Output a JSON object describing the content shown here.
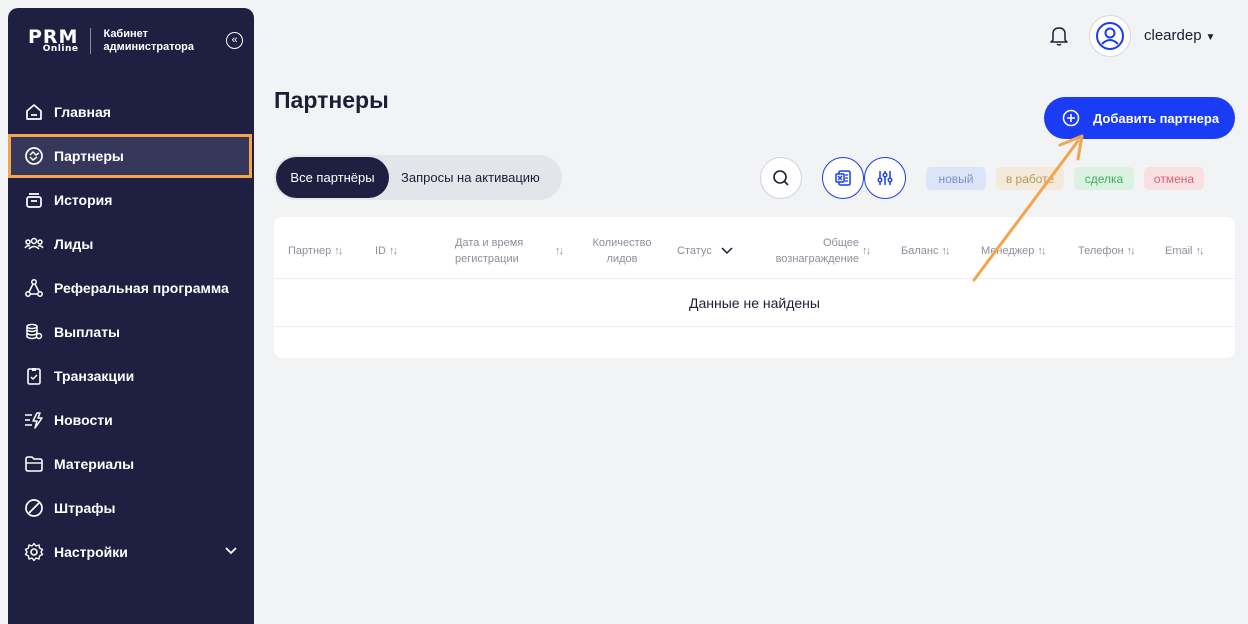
{
  "sidebar": {
    "logo_main": "PRM",
    "logo_sub": "Online",
    "cabinet_label": "Кабинет администратора",
    "items": [
      {
        "label": "Главная",
        "icon": "home-icon"
      },
      {
        "label": "Партнеры",
        "icon": "partners-icon",
        "active": true
      },
      {
        "label": "История",
        "icon": "history-icon"
      },
      {
        "label": "Лиды",
        "icon": "leads-icon"
      },
      {
        "label": "Реферальная программа",
        "icon": "referral-icon"
      },
      {
        "label": "Выплаты",
        "icon": "payouts-icon"
      },
      {
        "label": "Транзакции",
        "icon": "transactions-icon"
      },
      {
        "label": "Новости",
        "icon": "news-icon"
      },
      {
        "label": "Материалы",
        "icon": "materials-icon"
      },
      {
        "label": "Штрафы",
        "icon": "fines-icon"
      },
      {
        "label": "Настройки",
        "icon": "settings-icon"
      }
    ]
  },
  "header": {
    "username": "cleardep"
  },
  "main": {
    "title": "Партнеры",
    "add_button": "Добавить партнера",
    "tabs": [
      "Все партнёры",
      "Запросы на активацию"
    ],
    "badges": {
      "new": "новый",
      "in_work": "в работе",
      "deal": "сделка",
      "cancel": "отмена"
    },
    "columns": {
      "partner": "Партнер",
      "id": "ID",
      "reg_date_1": "Дата и время",
      "reg_date_2": "регистрации",
      "leads_1": "Количество",
      "leads_2": "лидов",
      "status": "Статус",
      "reward_1": "Общее",
      "reward_2": "вознаграждение",
      "balance": "Баланс",
      "manager": "Менеджер",
      "phone": "Телефон",
      "email": "Email"
    },
    "empty_text": "Данные не найдены"
  },
  "colors": {
    "sidebar_bg": "#1f2041",
    "accent": "#1a3cf4",
    "highlight": "#f2a54a"
  }
}
